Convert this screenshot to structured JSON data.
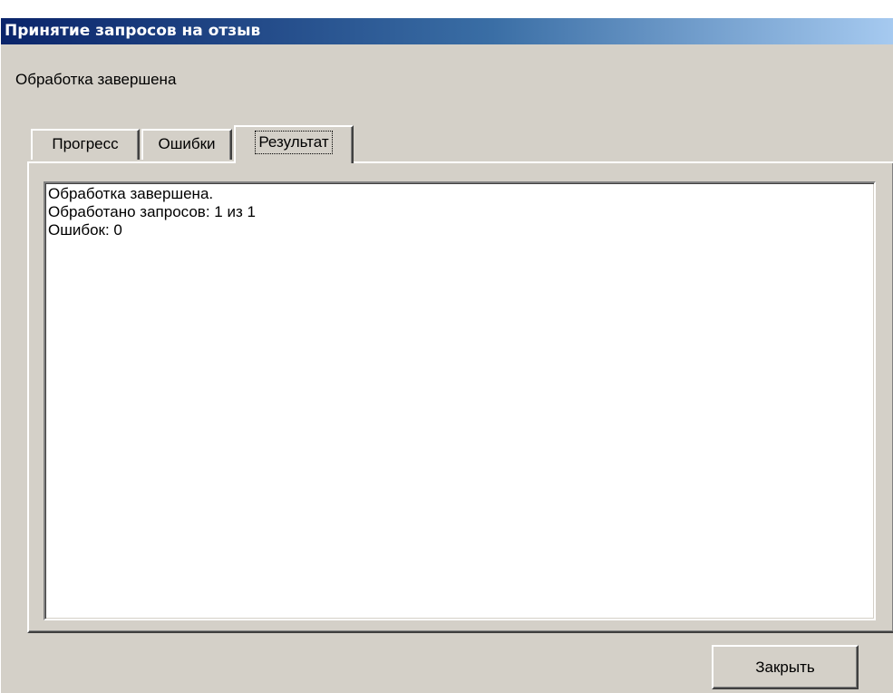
{
  "window": {
    "title": "Принятие запросов на отзыв",
    "colors": {
      "titlebar_start": "#0a246a",
      "titlebar_end": "#a6caf0",
      "face": "#d4d0c8"
    }
  },
  "status": {
    "text": "Обработка завершена"
  },
  "tabs": [
    {
      "label": "Прогресс",
      "active": false
    },
    {
      "label": "Ошибки",
      "active": false
    },
    {
      "label": "Результат",
      "active": true
    }
  ],
  "result": {
    "lines": [
      "Обработка завершена.",
      "Обработано запросов: 1 из 1",
      "Ошибок: 0"
    ]
  },
  "buttons": {
    "close_label": "Закрыть"
  }
}
